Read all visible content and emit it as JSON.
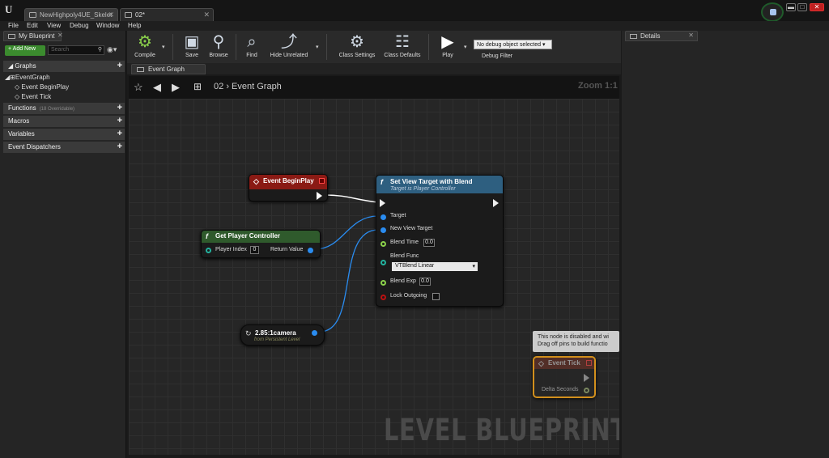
{
  "tabs": [
    {
      "label": "NewHighpoly4UE_Skelet"
    },
    {
      "label": "02*"
    }
  ],
  "window_controls": {
    "minimize": "▬",
    "maximize": "□",
    "close": "✕"
  },
  "menu": [
    "File",
    "Edit",
    "View",
    "Debug",
    "Window",
    "Help"
  ],
  "my_blueprint": {
    "tab_label": "My Blueprint",
    "add_new_label": "+ Add New",
    "search_placeholder": "Search",
    "graphs_label": "Graphs",
    "event_graph": "EventGraph",
    "events": [
      "Event BeginPlay",
      "Event Tick"
    ],
    "functions_label": "Functions",
    "functions_sub": "(18 Overridable)",
    "macros_label": "Macros",
    "variables_label": "Variables",
    "dispatchers_label": "Event Dispatchers"
  },
  "toolbar": {
    "compile": "Compile",
    "save": "Save",
    "browse": "Browse",
    "find": "Find",
    "hide_unrelated": "Hide Unrelated",
    "class_settings": "Class Settings",
    "class_defaults": "Class Defaults",
    "play": "Play",
    "debug_object": "No debug object selected",
    "debug_filter": "Debug Filter"
  },
  "graph": {
    "tab_label": "Event Graph",
    "breadcrumb_root": "02",
    "breadcrumb_sep": "›",
    "breadcrumb_current": "Event Graph",
    "zoom": "Zoom 1:1",
    "watermark": "LEVEL BLUEPRINT"
  },
  "nodes": {
    "begin_play": {
      "title": "Event BeginPlay"
    },
    "set_view_target": {
      "title": "Set View Target with Blend",
      "subtitle": "Target is Player Controller",
      "pins": {
        "target": "Target",
        "new_view_target": "New View Target",
        "blend_time": "Blend Time",
        "blend_time_value": "0.0",
        "blend_func": "Blend Func",
        "blend_func_value": "VTBlend Linear",
        "blend_exp": "Blend Exp",
        "blend_exp_value": "0.0",
        "lock_outgoing": "Lock Outgoing"
      }
    },
    "get_player_controller": {
      "title": "Get Player Controller",
      "player_index": "Player Index",
      "player_index_value": "0",
      "return_value": "Return Value"
    },
    "camera_ref": {
      "title": "2.85:1camera",
      "subtitle": "from Persistent Level"
    },
    "event_tick": {
      "title": "Event Tick",
      "delta_seconds": "Delta Seconds"
    },
    "disabled_tooltip": {
      "line1": "This node is disabled and wi",
      "line2": "Drag off pins to build functio"
    }
  },
  "details": {
    "tab_label": "Details"
  },
  "colors": {
    "event_header": "#8a1a14",
    "function_header": "#2e5f80",
    "pure_header": "#2f5a2c",
    "selection": "#f0a21b",
    "add_new": "#3b8b2e"
  }
}
